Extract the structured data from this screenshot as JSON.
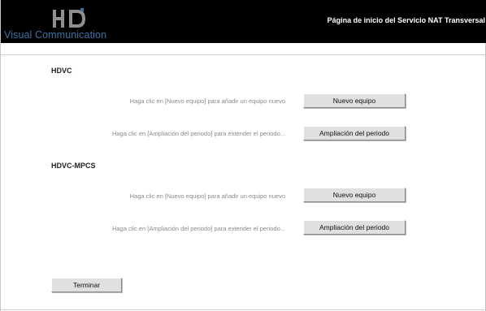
{
  "header": {
    "logo_text": "Visual Communication",
    "logo_mark_text": "HD",
    "title": "Página de inicio del Servicio NAT Transversal"
  },
  "sections": [
    {
      "title": "HDVC",
      "rows": [
        {
          "instruction": "Haga clic en [Nuevo equipo] para añadir un equipo nuevo",
          "button": "Nuevo equipo"
        },
        {
          "instruction": "Haga clic en [Ampliación del periodo] para extender el periodo...",
          "button": "Ampliación del periodo"
        }
      ]
    },
    {
      "title": "HDVC-MPCS",
      "rows": [
        {
          "instruction": "Haga clic en [Nuevo equipo] para añadir un equipo nuevo",
          "button": "Nuevo equipo"
        },
        {
          "instruction": "Haga clic en [Ampliación del periodo] para extender el periodo...",
          "button": "Ampliación del periodo"
        }
      ]
    }
  ],
  "footer": {
    "finish_button": "Terminar"
  },
  "colors": {
    "header_bg": "#000000",
    "logo_text": "#3e72a6",
    "button_bg": "#e0e0e0",
    "instruction_text": "#8a8a8a"
  }
}
